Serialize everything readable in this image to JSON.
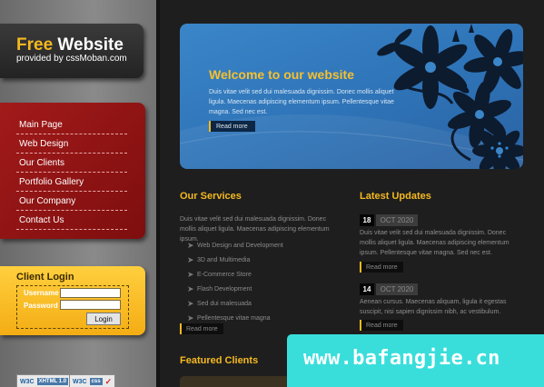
{
  "logo": {
    "title_accent": "Free",
    "title_rest": " Website",
    "subtitle": "provided by cssMoban.com"
  },
  "menu": {
    "items": [
      {
        "label": "Main Page"
      },
      {
        "label": "Web Design"
      },
      {
        "label": "Our Clients"
      },
      {
        "label": "Portfolio Gallery"
      },
      {
        "label": "Our Company"
      },
      {
        "label": "Contact Us"
      }
    ]
  },
  "login": {
    "title": "Client Login",
    "username_label": "Username",
    "password_label": "Password",
    "button": "Login",
    "username_value": "",
    "password_value": ""
  },
  "badges": [
    {
      "w3c": "W3C",
      "kind": "XHTML 1.0",
      "mark": "✓"
    },
    {
      "w3c": "W3C",
      "kind": "css",
      "mark": "✓"
    }
  ],
  "banner": {
    "title": "Welcome to our website",
    "text": "Duis vitae velit sed dui malesuada dignissim. Donec mollis aliquet ligula. Maecenas adipiscing elementum ipsum. Pellentesque vitae magna. Sed nec est.",
    "button": "Read more"
  },
  "services": {
    "title": "Our Services",
    "text": "Duis vitae velit sed dui malesuada dignissim. Donec mollis aliquet ligula. Maecenas adipiscing elementum ipsum.",
    "items": [
      {
        "label": "Web Design and Development"
      },
      {
        "label": "3D and Multimedia"
      },
      {
        "label": "E-Commerce Store"
      },
      {
        "label": "Flash Development"
      },
      {
        "label": "Sed dui malesuada"
      },
      {
        "label": "Pellentesque vitae magna"
      }
    ],
    "more": "Read more"
  },
  "updates": {
    "title": "Latest Updates",
    "entries": [
      {
        "day": "18",
        "month": "OCT 2020",
        "text": "Duis vitae velit sed dui malesuada dignissim. Donec mollis aliquet ligula. Maecenas adipiscing elementum ipsum. Pellentesque vitae magna. Sed nec est.",
        "more": "Read more"
      },
      {
        "day": "14",
        "month": "OCT 2020",
        "text": "Aenean cursus. Maecenas aliquam, ligula it egestas suscipit, nisi sapien dignissim nibh, ac vestibulum.",
        "more": "Read more"
      }
    ]
  },
  "clients": {
    "title": "Featured Clients"
  },
  "watermark": {
    "text": "www.bafangjie.cn"
  },
  "colors": {
    "accent": "#f5b920",
    "menu_red": "#8e1313",
    "banner_blue": "#2e73b7",
    "watermark_cyan": "#39dedb"
  }
}
